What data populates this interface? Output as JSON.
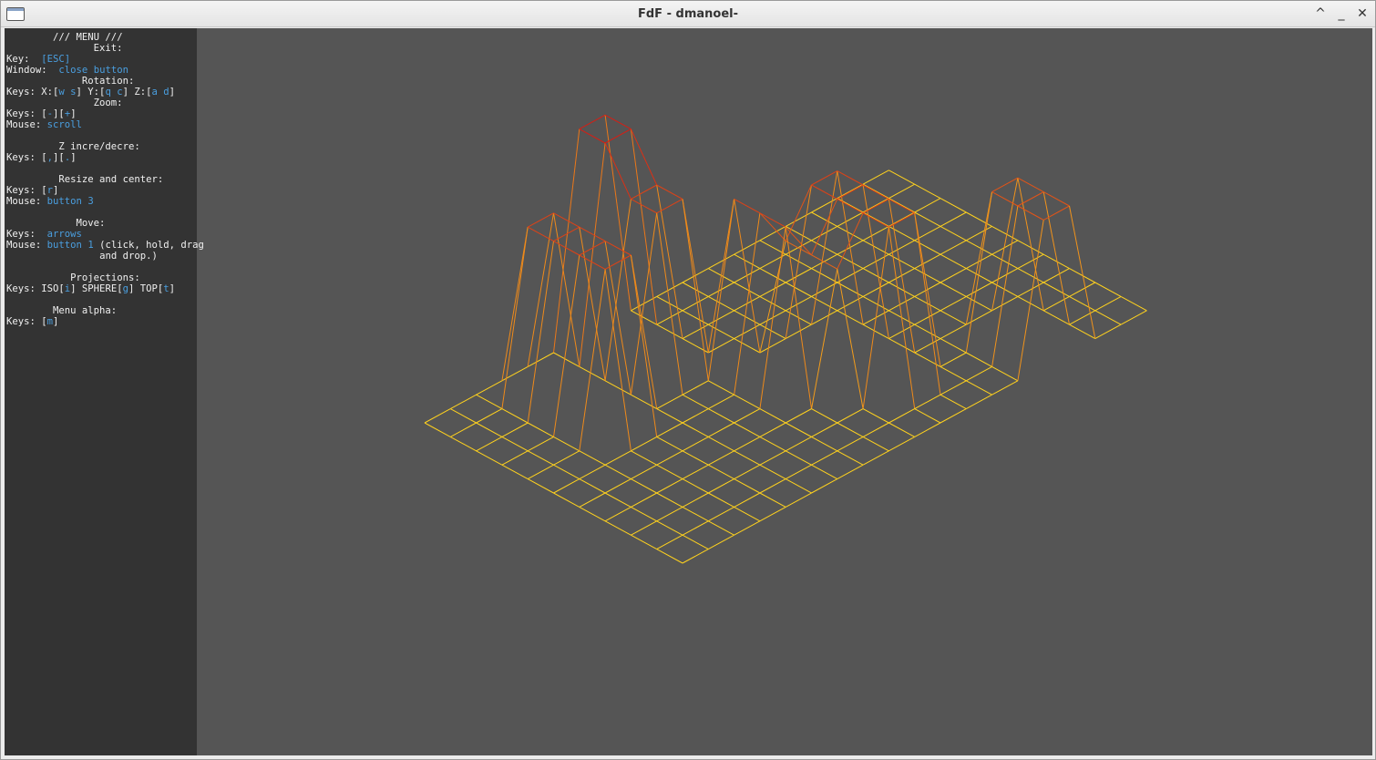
{
  "window": {
    "title": "FdF - dmanoel-",
    "controls": {
      "maximize": "^",
      "minimize": "_",
      "close": "✕"
    }
  },
  "menu": {
    "header": "/// MENU ///",
    "exit": {
      "title": "Exit:",
      "key_label": "Key:",
      "key_value": "[ESC]",
      "window_label": "Window:",
      "window_value": "close button"
    },
    "rotation": {
      "title": "Rotation:",
      "keys_label": "Keys: X:[",
      "x_keys": "w s",
      "y_label": "] Y:[",
      "y_keys": "q c",
      "z_label": "] Z:[",
      "z_keys": "a d",
      "end": "]"
    },
    "zoom": {
      "title": "Zoom:",
      "keys_label": "Keys: [",
      "minus": "-",
      "mid": "][",
      "plus": "+",
      "end": "]",
      "mouse_label": "Mouse:",
      "mouse_value": "scroll"
    },
    "z_scale": {
      "title": "Z incre/decre:",
      "keys_label": "Keys: [",
      "dec": ",",
      "mid": "][",
      "inc": ".",
      "end": "]"
    },
    "resize": {
      "title": "Resize and center:",
      "keys_label": "Keys: [",
      "key": "r",
      "end": "]",
      "mouse_label": "Mouse:",
      "mouse_value": "button 3"
    },
    "move": {
      "title": "Move:",
      "keys_label": "Keys:",
      "keys_value": "arrows",
      "mouse_label": "Mouse:",
      "mouse_value": "button 1",
      "mouse_note": "(click, hold, drag",
      "mouse_note2": "and drop.)"
    },
    "projections": {
      "title": "Projections:",
      "keys_label": "Keys: ISO[",
      "iso_key": "i",
      "sphere_label": "] SPHERE[",
      "sphere_key": "g",
      "top_label": "] TOP[",
      "top_key": "t",
      "end": "]"
    },
    "alpha": {
      "title": "Menu alpha:",
      "keys_label": "Keys: [",
      "key": "m",
      "end": "]"
    }
  },
  "fdf_view": {
    "background_color": "#555555",
    "low_color": "#ffd21e",
    "high_color": "#d71e14",
    "projection": "isometric",
    "grid_cols": 19,
    "grid_rows": 11,
    "blocks": [
      {
        "cells": "row 0-1, col 6-7",
        "height": 10
      },
      {
        "cells": "row 2-3, col 6-7",
        "height": 8
      },
      {
        "cells": "row 1-4, col 3-4",
        "height": 8
      },
      {
        "cells": "row 4-6, col 8",
        "height": 8
      },
      {
        "cells": "row 5-7, col 9",
        "height": 6
      },
      {
        "cells": "row 5-8, col 10-11",
        "height": 8
      },
      {
        "cells": "row 8-10, col 14-15",
        "height": 7
      }
    ]
  }
}
